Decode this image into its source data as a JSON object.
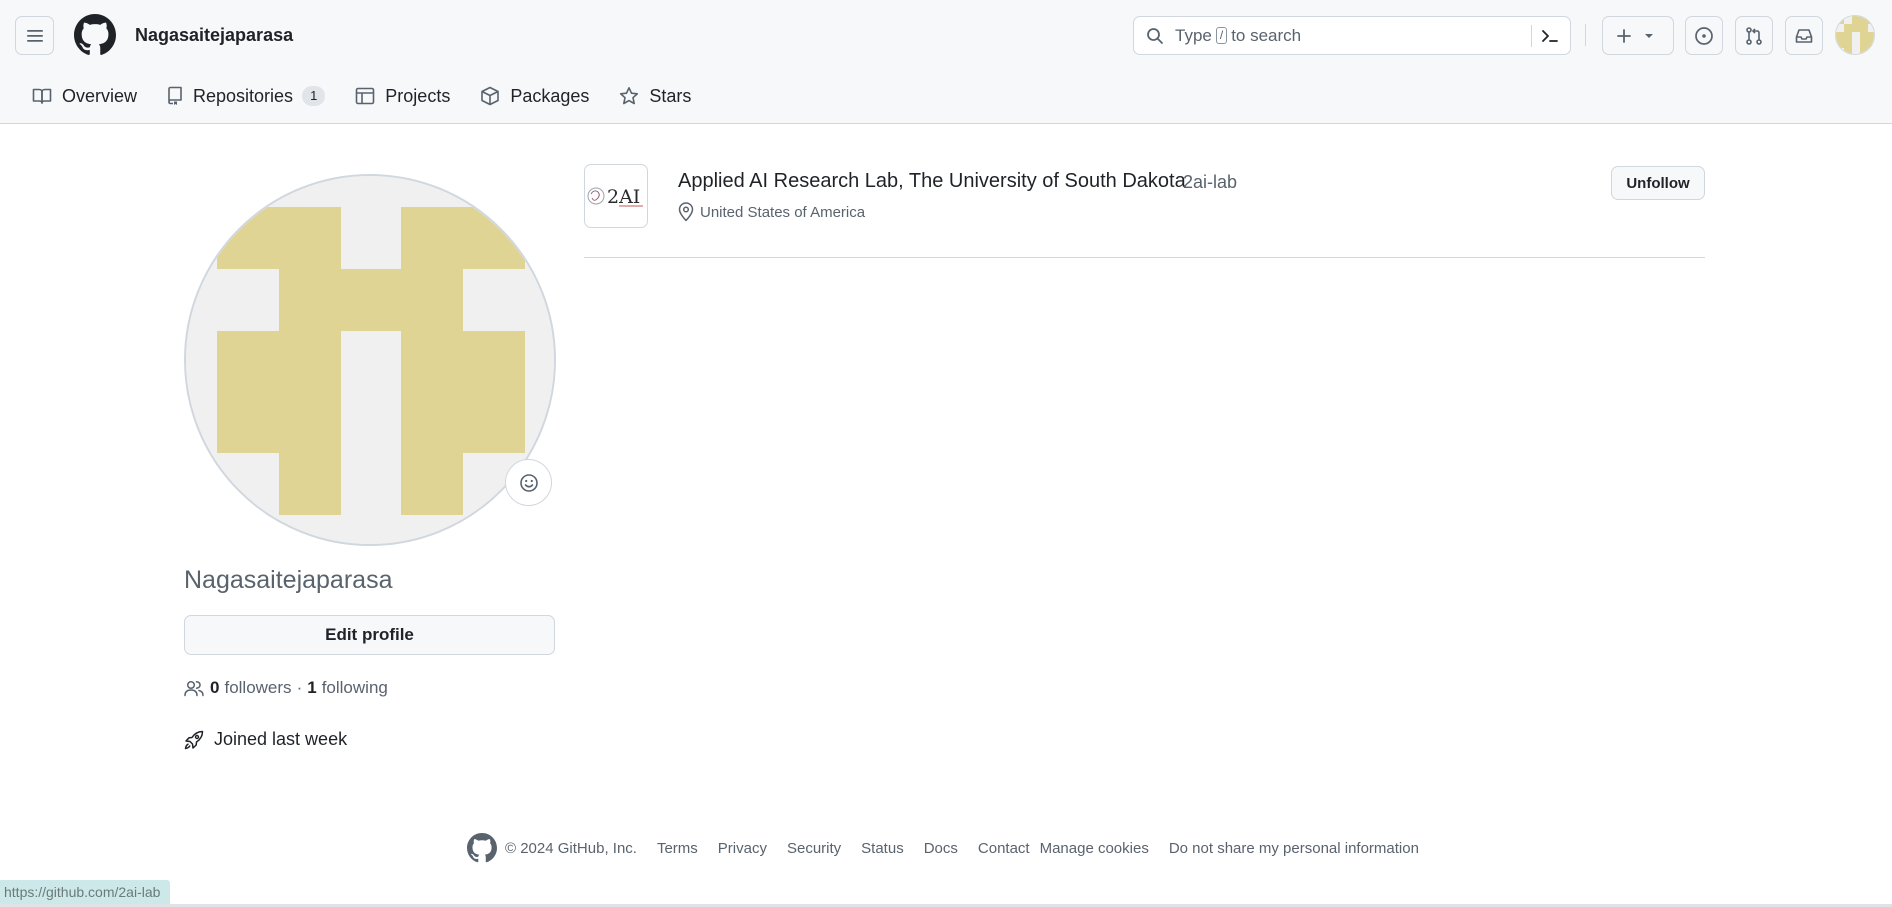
{
  "header": {
    "context_title": "Nagasaitejaparasa",
    "search": {
      "pre": "Type",
      "key": "/",
      "post": "to search"
    }
  },
  "tabs": [
    {
      "label": "Overview",
      "icon": "book-icon"
    },
    {
      "label": "Repositories",
      "icon": "repo-icon",
      "count": "1"
    },
    {
      "label": "Projects",
      "icon": "table-icon"
    },
    {
      "label": "Packages",
      "icon": "package-icon"
    },
    {
      "label": "Stars",
      "icon": "star-icon"
    }
  ],
  "profile": {
    "username": "Nagasaitejaparasa",
    "edit_label": "Edit profile",
    "followers_count": "0",
    "followers_label": "followers",
    "dot": "·",
    "following_count": "1",
    "following_label": "following",
    "joined": "Joined last week",
    "avatar_color": "#e0d494"
  },
  "following_list": [
    {
      "name": "Applied AI Research Lab, The University of South Dakota",
      "login": "2ai-lab",
      "location": "United States of America",
      "button": "Unfollow",
      "logo_text": "2AI"
    }
  ],
  "footer": {
    "copyright": "© 2024 GitHub, Inc.",
    "links": [
      "Terms",
      "Privacy",
      "Security",
      "Status",
      "Docs",
      "Contact",
      "Manage cookies",
      "Do not share my personal information"
    ]
  },
  "status_bar_url": "https://github.com/2ai-lab",
  "colors": {
    "accent": "#1f2328",
    "muted": "#59636e",
    "border": "#d0d7de",
    "avatar": "#e0d494"
  }
}
